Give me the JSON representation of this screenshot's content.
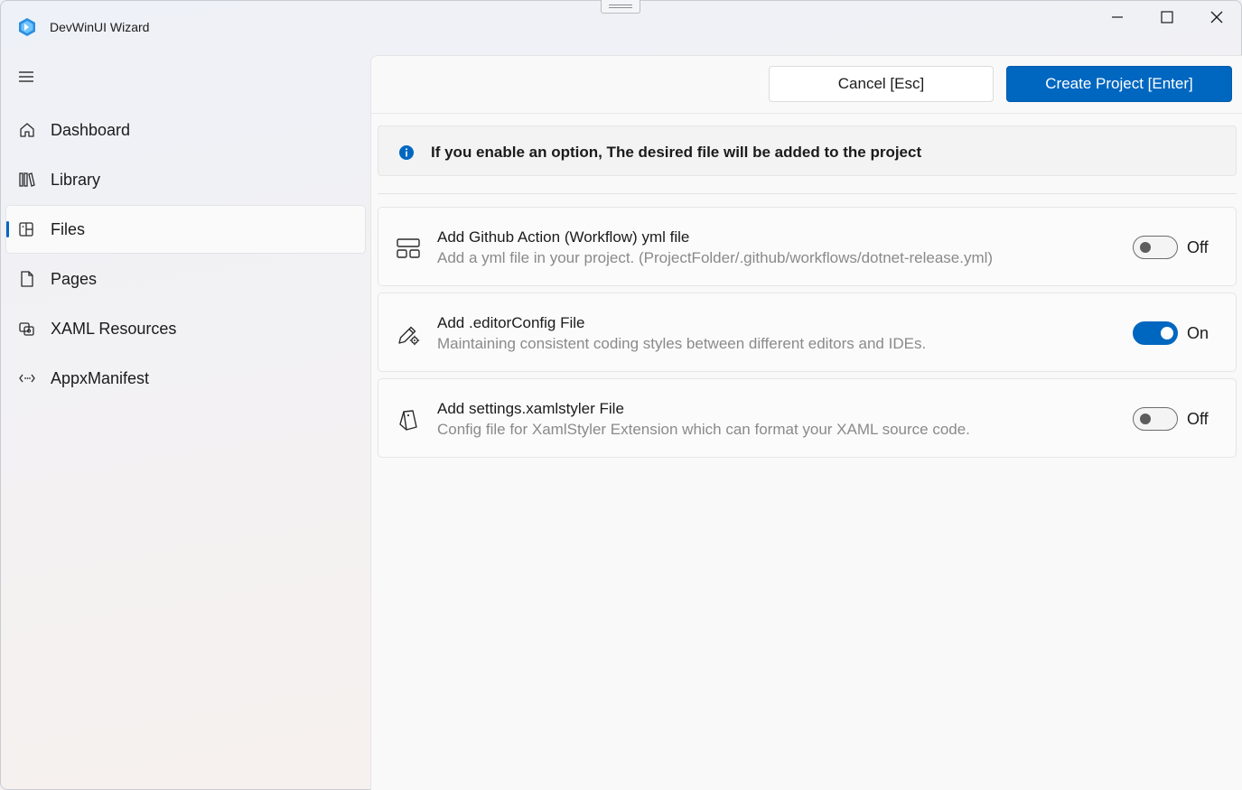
{
  "window": {
    "title": "DevWinUI Wizard"
  },
  "nav": {
    "items": [
      {
        "label": "Dashboard",
        "icon": "home-icon"
      },
      {
        "label": "Library",
        "icon": "library-icon"
      },
      {
        "label": "Files",
        "icon": "files-icon",
        "selected": true
      },
      {
        "label": "Pages",
        "icon": "page-icon"
      },
      {
        "label": "XAML Resources",
        "icon": "resources-icon"
      },
      {
        "label": "AppxManifest",
        "icon": "manifest-icon"
      }
    ]
  },
  "commands": {
    "cancel_label": "Cancel [Esc]",
    "create_label": "Create Project [Enter]"
  },
  "info": {
    "message": "If you enable an option, The desired file will be added to the project"
  },
  "options": [
    {
      "title": "Add Github Action (Workflow) yml file",
      "description": "Add a yml file in your project. (ProjectFolder/.github/workflows/dotnet-release.yml)",
      "state": "Off",
      "enabled": false,
      "icon": "layout-icon"
    },
    {
      "title": "Add .editorConfig File",
      "description": "Maintaining consistent coding styles between different editors and IDEs.",
      "state": "On",
      "enabled": true,
      "icon": "edit-settings-icon"
    },
    {
      "title": "Add settings.xamlstyler File",
      "description": "Config file for XamlStyler Extension which can format your XAML source code.",
      "state": "Off",
      "enabled": false,
      "icon": "style-icon"
    }
  ],
  "colors": {
    "accent": "#0067c0",
    "info": "#0067c0"
  }
}
